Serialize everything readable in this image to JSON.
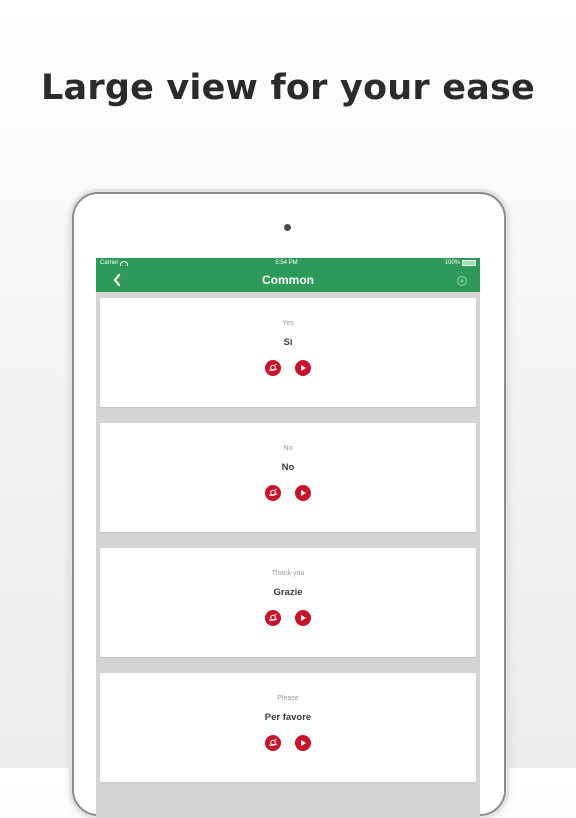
{
  "headline": "Large view for your ease",
  "status": {
    "carrier": "Carrier",
    "time": "5:54 PM",
    "battery": "100%"
  },
  "nav": {
    "title": "Common"
  },
  "colors": {
    "header": "#2e9a59",
    "accent": "#c8142a"
  },
  "phrases": [
    {
      "english": "Yes",
      "italian": "Sì"
    },
    {
      "english": "No",
      "italian": "No"
    },
    {
      "english": "Thank you",
      "italian": "Grazie"
    },
    {
      "english": "Please",
      "italian": "Per favore"
    }
  ]
}
